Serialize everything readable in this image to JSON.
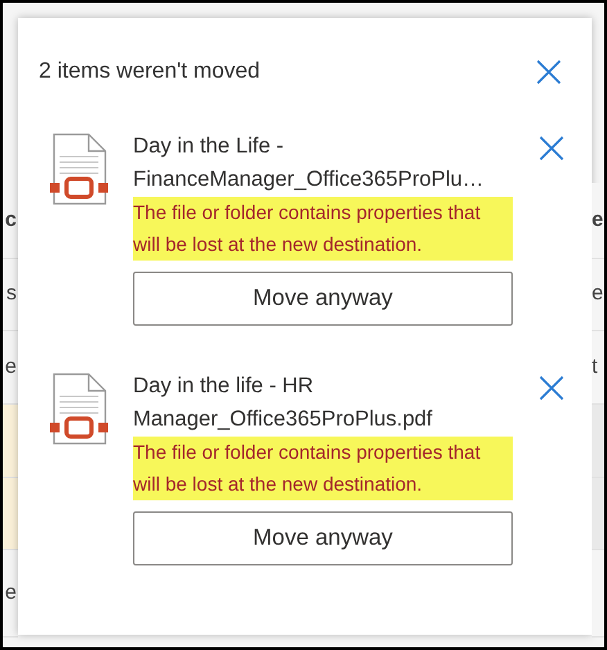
{
  "background": {
    "left_rows": [
      {
        "kind": "header",
        "text": "c"
      },
      {
        "kind": "row",
        "text": "s"
      },
      {
        "kind": "row",
        "text": "e"
      },
      {
        "kind": "highlight"
      },
      {
        "kind": "highlight"
      },
      {
        "kind": "row",
        "text": "e"
      }
    ],
    "right_rows": [
      {
        "kind": "header",
        "text": "e"
      },
      {
        "kind": "row",
        "text": "e"
      },
      {
        "kind": "row",
        "text": "t"
      },
      {
        "kind": "shaded"
      },
      {
        "kind": "shaded"
      },
      {
        "kind": "row"
      }
    ]
  },
  "panel": {
    "title": "2 items weren't moved",
    "items": [
      {
        "name": "Day in the Life - FinanceManager_Office365ProPlu…",
        "message": "The file or folder contains properties that will be lost at the new destination.",
        "button": "Move anyway"
      },
      {
        "name": "Day in the life - HR Manager_Office365ProPlus.pdf",
        "message": "The file or folder contains properties that will be lost at the new destination.",
        "button": "Move anyway"
      }
    ]
  }
}
